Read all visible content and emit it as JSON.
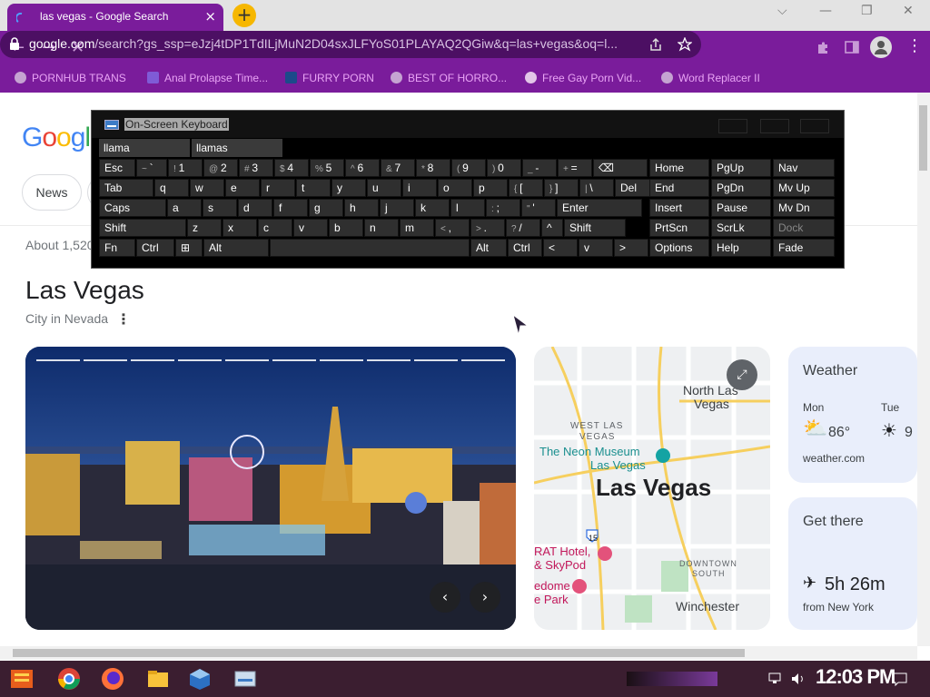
{
  "browser": {
    "tab_title": "las vegas - Google Search",
    "tab_close": "×",
    "new_tab": "+",
    "url_main": "google.com",
    "url_rest": "/search?gs_ssp=eJzj4tDP1TdILjMuN2D04sxJLFYoS01PLAYAQ2QGiw&q=las+vegas&oq=l...",
    "window_controls": {
      "minimize": "—",
      "restore": "❐",
      "close": "✕",
      "menu": "⌵"
    }
  },
  "bookmarks": [
    {
      "label": "PORNHUB TRANS",
      "icon": "globe-icon"
    },
    {
      "label": "Anal Prolapse Time...",
      "icon": "bookmark-icon"
    },
    {
      "label": "FURRY PORN",
      "icon": "arch-icon"
    },
    {
      "label": "BEST OF HORRO...",
      "icon": "globe-icon"
    },
    {
      "label": "Free Gay Porn Vid...",
      "icon": "pig-icon"
    },
    {
      "label": "Word Replacer II",
      "icon": "globe-icon"
    }
  ],
  "page": {
    "logo": "Google",
    "news_chip": "News",
    "about": "About 1,520",
    "kp_title": "Las Vegas",
    "kp_subtitle": "City in Nevada",
    "kp_more": "⋮",
    "photo_prev": "‹",
    "photo_next": "›",
    "map": {
      "title": "Las Vegas",
      "north": "North Las",
      "north2": "Vegas",
      "westlas": "WEST LAS",
      "westlas2": "VEGAS",
      "neon": "The Neon Museum",
      "neon2": "Las Vegas",
      "hotel": "RAT Hotel,",
      "hotel2": "& SkyPod",
      "downtown": "DOWNTOWN",
      "downtown2": "SOUTH",
      "dome": "edome",
      "dome2": "e Park",
      "winchester": "Winchester",
      "shield15": "15",
      "expand": "⤢"
    },
    "weather": {
      "heading": "Weather",
      "day1": "Mon",
      "temp1": "86°",
      "day2": "Tue",
      "temp2": "9",
      "source": "weather.com"
    },
    "directions": {
      "heading": "Get there",
      "duration": "5h 26m",
      "from": "from New York"
    }
  },
  "osk": {
    "title": "On-Screen Keyboard",
    "predictions": [
      "llama",
      "llamas"
    ],
    "rows": [
      [
        {
          "l": "Esc"
        },
        {
          "s": "~",
          "l": "`"
        },
        {
          "s": "!",
          "l": "1"
        },
        {
          "s": "@",
          "l": "2"
        },
        {
          "s": "#",
          "l": "3"
        },
        {
          "s": "$",
          "l": "4"
        },
        {
          "s": "%",
          "l": "5"
        },
        {
          "s": "^",
          "l": "6"
        },
        {
          "s": "&",
          "l": "7"
        },
        {
          "s": "*",
          "l": "8"
        },
        {
          "s": "(",
          "l": "9"
        },
        {
          "s": ")",
          "l": "0"
        },
        {
          "s": "_",
          "l": "-"
        },
        {
          "s": "+",
          "l": "="
        },
        {
          "l": "⌫"
        }
      ],
      [
        {
          "l": "Tab"
        },
        {
          "l": "q"
        },
        {
          "l": "w"
        },
        {
          "l": "e"
        },
        {
          "l": "r"
        },
        {
          "l": "t"
        },
        {
          "l": "y"
        },
        {
          "l": "u"
        },
        {
          "l": "i"
        },
        {
          "l": "o"
        },
        {
          "l": "p"
        },
        {
          "s": "{",
          "l": "["
        },
        {
          "s": "}",
          "l": "]"
        },
        {
          "s": "|",
          "l": "\\"
        },
        {
          "l": "Del"
        }
      ],
      [
        {
          "l": "Caps"
        },
        {
          "l": "a"
        },
        {
          "l": "s"
        },
        {
          "l": "d"
        },
        {
          "l": "f"
        },
        {
          "l": "g"
        },
        {
          "l": "h"
        },
        {
          "l": "j"
        },
        {
          "l": "k"
        },
        {
          "l": "l"
        },
        {
          "s": ":",
          "l": ";"
        },
        {
          "s": "\"",
          "l": "'"
        },
        {
          "l": "Enter"
        }
      ],
      [
        {
          "l": "Shift"
        },
        {
          "l": "z"
        },
        {
          "l": "x"
        },
        {
          "l": "c"
        },
        {
          "l": "v"
        },
        {
          "l": "b"
        },
        {
          "l": "n"
        },
        {
          "l": "m"
        },
        {
          "s": "<",
          "l": ","
        },
        {
          "s": ">",
          "l": "."
        },
        {
          "s": "?",
          "l": "/"
        },
        {
          "l": "^"
        },
        {
          "l": "Shift"
        }
      ],
      [
        {
          "l": "Fn"
        },
        {
          "l": "Ctrl"
        },
        {
          "l": "⊞"
        },
        {
          "l": "Alt"
        },
        {
          "l": ""
        },
        {
          "l": "Alt"
        },
        {
          "l": "Ctrl"
        },
        {
          "l": "<"
        },
        {
          "l": "v"
        },
        {
          "l": ">"
        },
        {
          "l": "▤"
        }
      ]
    ],
    "nav": [
      [
        "Home",
        "PgUp",
        "Nav"
      ],
      [
        "End",
        "PgDn",
        "Mv Up"
      ],
      [
        "Insert",
        "Pause",
        "Mv Dn"
      ],
      [
        "PrtScn",
        "ScrLk",
        "Dock"
      ],
      [
        "Options",
        "Help",
        "Fade"
      ]
    ]
  },
  "taskbar": {
    "clock": "12:03 PM",
    "tray": [
      "network-icon",
      "volume-icon"
    ]
  }
}
